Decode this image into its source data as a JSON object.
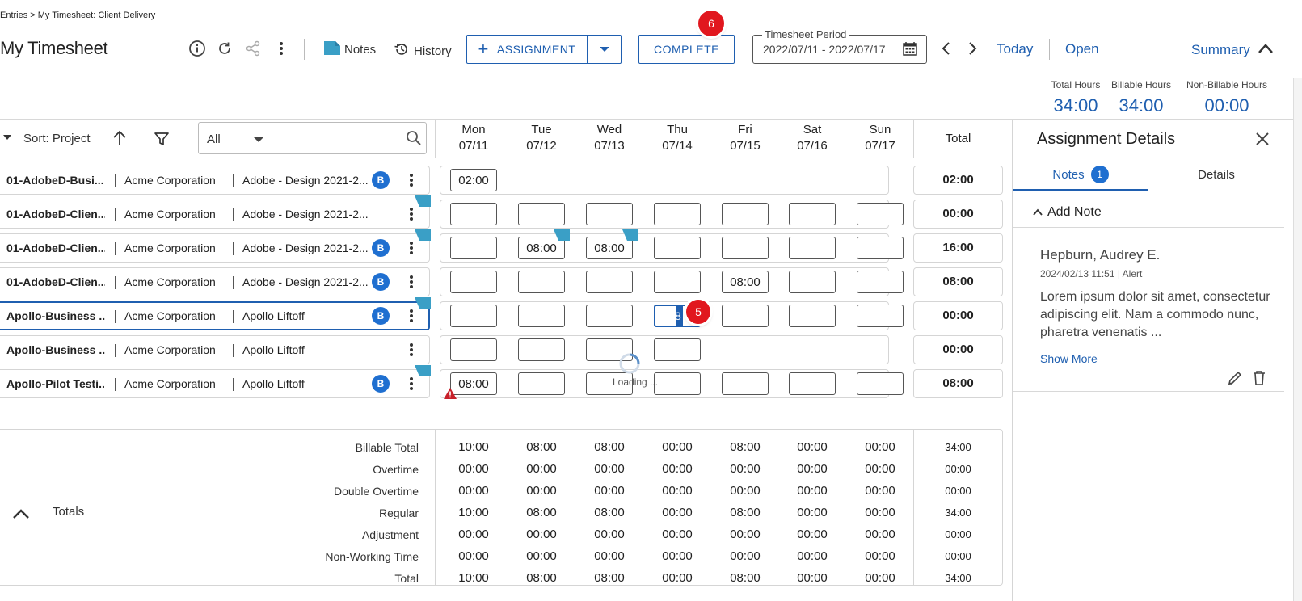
{
  "breadcrumb": "Entries > My Timesheet: Client Delivery",
  "page_title": "My Timesheet",
  "toolbar": {
    "info_icon": "info-circle-icon",
    "refresh_icon": "refresh-icon",
    "share_icon": "share-icon",
    "notes_label": "Notes",
    "history_label": "History",
    "assignment_label": "ASSIGNMENT",
    "complete_label": "COMPLETE",
    "complete_badge": "6",
    "period_legend": "Timesheet Period",
    "period_value": "2022/07/11 - 2022/07/17",
    "today_label": "Today",
    "open_label": "Open",
    "summary_label": "Summary"
  },
  "hours_summary": [
    {
      "label": "Total Hours",
      "value": "34:00"
    },
    {
      "label": "Billable Hours",
      "value": "34:00"
    },
    {
      "label": "Non-Billable Hours",
      "value": "00:00"
    }
  ],
  "grid": {
    "sort_label": "Sort: Project",
    "filter_value": "All",
    "days": [
      {
        "day": "Mon",
        "date": "07/11"
      },
      {
        "day": "Tue",
        "date": "07/12"
      },
      {
        "day": "Wed",
        "date": "07/13"
      },
      {
        "day": "Thu",
        "date": "07/14"
      },
      {
        "day": "Fri",
        "date": "07/15"
      },
      {
        "day": "Sat",
        "date": "07/16"
      },
      {
        "day": "Sun",
        "date": "07/17"
      }
    ],
    "total_header": "Total",
    "loading_text": "Loading ...",
    "edit_badge": "5",
    "rows": [
      {
        "code": "01-AdobeD-Busi...",
        "client": "Acme Corporation",
        "project": "Adobe - Design 2021-2...",
        "billable": "B",
        "times": [
          "02:00"
        ],
        "total": "02:00"
      },
      {
        "code": "01-AdobeD-Clien...",
        "client": "Acme Corporation",
        "project": "Adobe - Design 2021-2...",
        "billable": "",
        "times": [
          "",
          "",
          "",
          "",
          "",
          "",
          ""
        ],
        "total": "00:00"
      },
      {
        "code": "01-AdobeD-Clien...",
        "client": "Acme Corporation",
        "project": "Adobe - Design 2021-2...",
        "billable": "B",
        "times": [
          "",
          "08:00",
          "08:00",
          "",
          "",
          "",
          ""
        ],
        "total": "16:00"
      },
      {
        "code": "01-AdobeD-Clien...",
        "client": "Acme Corporation",
        "project": "Adobe - Design 2021-2...",
        "billable": "B",
        "times": [
          "",
          "",
          "",
          "",
          "08:00",
          "",
          ""
        ],
        "total": "08:00"
      },
      {
        "code": "Apollo-Business ...",
        "client": "Acme Corporation",
        "project": "Apollo Liftoff",
        "billable": "B",
        "times": [
          "",
          "",
          "",
          "8",
          "",
          "",
          ""
        ],
        "total": "00:00"
      },
      {
        "code": "Apollo-Business ...",
        "client": "Acme Corporation",
        "project": "Apollo Liftoff",
        "billable": "",
        "times": [
          "",
          "",
          "",
          ""
        ],
        "total": "00:00"
      },
      {
        "code": "Apollo-Pilot Testi...",
        "client": "Acme Corporation",
        "project": "Apollo Liftoff",
        "billable": "B",
        "times": [
          "08:00",
          "",
          "",
          "",
          "",
          "",
          ""
        ],
        "total": "08:00"
      }
    ]
  },
  "totals": {
    "section_label": "Totals",
    "rows": [
      {
        "label": "Billable Total",
        "values": [
          "10:00",
          "08:00",
          "08:00",
          "00:00",
          "08:00",
          "00:00",
          "00:00"
        ],
        "sum": "34:00"
      },
      {
        "label": "Overtime",
        "values": [
          "00:00",
          "00:00",
          "00:00",
          "00:00",
          "00:00",
          "00:00",
          "00:00"
        ],
        "sum": "00:00"
      },
      {
        "label": "Double Overtime",
        "values": [
          "00:00",
          "00:00",
          "00:00",
          "00:00",
          "00:00",
          "00:00",
          "00:00"
        ],
        "sum": "00:00"
      },
      {
        "label": "Regular",
        "values": [
          "10:00",
          "08:00",
          "08:00",
          "00:00",
          "08:00",
          "00:00",
          "00:00"
        ],
        "sum": "34:00"
      },
      {
        "label": "Adjustment",
        "values": [
          "00:00",
          "00:00",
          "00:00",
          "00:00",
          "00:00",
          "00:00",
          "00:00"
        ],
        "sum": "00:00"
      },
      {
        "label": "Non-Working Time",
        "values": [
          "00:00",
          "00:00",
          "00:00",
          "00:00",
          "00:00",
          "00:00",
          "00:00"
        ],
        "sum": "00:00"
      },
      {
        "label": "Total",
        "values": [
          "10:00",
          "08:00",
          "08:00",
          "00:00",
          "08:00",
          "00:00",
          "00:00"
        ],
        "sum": "34:00"
      }
    ]
  },
  "assignment_details": {
    "title": "Assignment Details",
    "tab_notes": "Notes",
    "tab_notes_count": "1",
    "tab_details": "Details",
    "add_note": "Add Note",
    "note": {
      "author": "Hepburn, Audrey E.",
      "meta": "2024/02/13 11:51 | Alert",
      "text": "Lorem ipsum dolor sit amet, consectetur adipiscing elit. Nam a commodo nunc, pharetra venenatis ...",
      "show_more": "Show More"
    }
  },
  "colors": {
    "accent": "#1f5fb0",
    "badge_red": "#e1171e",
    "billable_badge": "#1f6fd0",
    "note_flag": "#3a9fc6",
    "alert": "#c8202a"
  }
}
